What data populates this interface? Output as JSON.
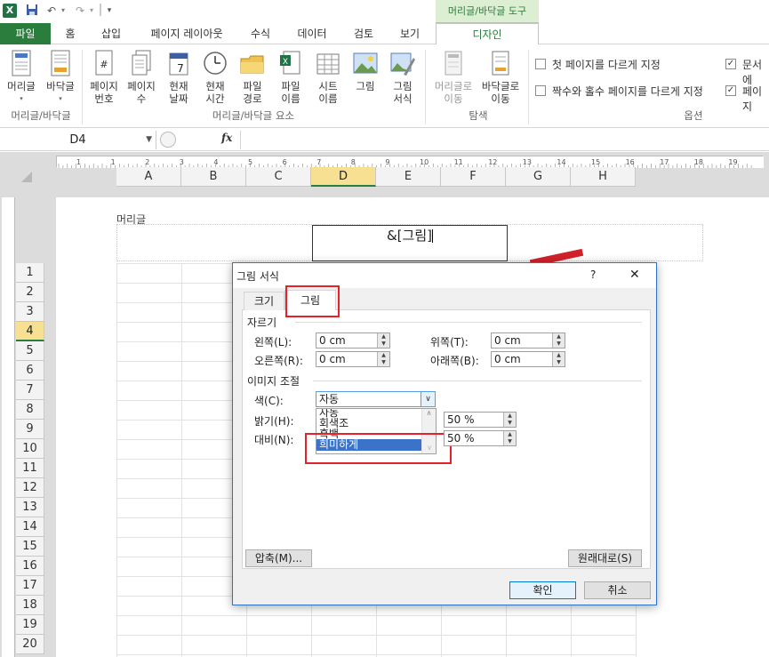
{
  "qat": {
    "undo_icon": "undo-icon",
    "redo_icon": "redo-icon",
    "save_icon": "save-icon"
  },
  "tabs": {
    "file": "파일",
    "home": "홈",
    "insert": "삽입",
    "page_layout": "페이지 레이아웃",
    "formulas": "수식",
    "data": "데이터",
    "review": "검토",
    "view": "보기",
    "context_group": "머리글/바닥글 도구",
    "design": "디자인"
  },
  "ribbon": {
    "hf_group": {
      "header": "머리글",
      "footer": "바닥글",
      "label": "머리글/바닥글"
    },
    "elements_group": {
      "label": "머리글/바닥글 요소",
      "items": [
        {
          "l1": "페이지",
          "l2": "번호"
        },
        {
          "l1": "페이지",
          "l2": "수"
        },
        {
          "l1": "현재",
          "l2": "날짜"
        },
        {
          "l1": "현재",
          "l2": "시간"
        },
        {
          "l1": "파일",
          "l2": "경로"
        },
        {
          "l1": "파일",
          "l2": "이름"
        },
        {
          "l1": "시트",
          "l2": "이름"
        },
        {
          "l1": "그림",
          "l2": ""
        },
        {
          "l1": "그림",
          "l2": "서식"
        }
      ]
    },
    "nav_group": {
      "label": "탐색",
      "goto_header_l1": "머리글로",
      "goto_header_l2": "이동",
      "goto_footer_l1": "바닥글로",
      "goto_footer_l2": "이동"
    },
    "options_group": {
      "label": "옵션",
      "diff_first": "첫 페이지를 다르게 지정",
      "diff_odd_even": "짝수와 홀수 페이지를 다르게 지정",
      "scale_doc": "문서에",
      "align_margins": "페이지"
    }
  },
  "formula_bar": {
    "name_box": "D4",
    "fx": "fx"
  },
  "sheet": {
    "columns": [
      "A",
      "B",
      "C",
      "D",
      "E",
      "F",
      "G",
      "H"
    ],
    "rows": [
      "1",
      "2",
      "3",
      "4",
      "5",
      "6",
      "7",
      "8",
      "9",
      "10",
      "11",
      "12",
      "13",
      "14",
      "15",
      "16",
      "17",
      "18",
      "19",
      "20"
    ],
    "header_label": "머리글",
    "header_code": "&[그림]",
    "ruler_labels": [
      "1",
      "1",
      "2",
      "3",
      "4",
      "5",
      "6",
      "7",
      "8",
      "9",
      "10",
      "11",
      "12",
      "13",
      "14",
      "15",
      "16",
      "17",
      "18",
      "19"
    ]
  },
  "dialog": {
    "title": "그림 서식",
    "help": "?",
    "close": "✕",
    "tab_size": "크기",
    "tab_picture": "그림",
    "crop_section": "자르기",
    "left_label": "왼쪽(L):",
    "left_value": "0 cm",
    "right_label": "오른쪽(R):",
    "right_value": "0 cm",
    "top_label": "위쪽(T):",
    "top_value": "0 cm",
    "bottom_label": "아래쪽(B):",
    "bottom_value": "0 cm",
    "adjust_section": "이미지 조절",
    "color_label": "색(C):",
    "color_value": "자동",
    "color_options": [
      "자동",
      "회색조",
      "흑백",
      "희미하게"
    ],
    "brightness_label": "밝기(H):",
    "brightness_value": "50 %",
    "contrast_label": "대비(N):",
    "contrast_value": "50 %",
    "compress_btn": "압축(M)...",
    "reset_btn": "원래대로(S)",
    "ok_btn": "확인",
    "cancel_btn": "취소"
  }
}
